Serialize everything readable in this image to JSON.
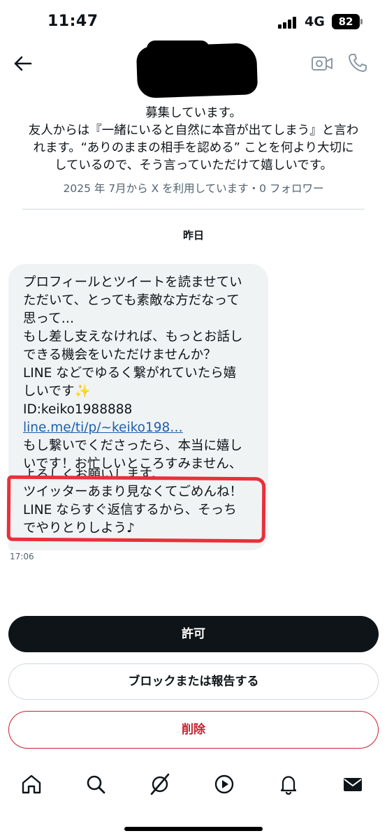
{
  "status_bar": {
    "time": "11:47",
    "network": "4G",
    "battery": "82"
  },
  "header": {
    "back_icon": "arrow-left-icon",
    "name_redacted": true,
    "video_icon": "video-camera-icon",
    "phone_icon": "phone-icon"
  },
  "profile": {
    "bio_lines": [
      "募集しています。",
      "友人からは『一緒にいると自然に本音が出てしまう』と言わ",
      "れます。“ありのままの相手を認める” ことを何より大切に",
      "しているので、そう言っていただけて嬉しいです。"
    ],
    "joined_text": "2025 年 7月から X を利用しています・0 フォロワー"
  },
  "conversation": {
    "date_separator": "昨日",
    "message": {
      "lines": [
        "プロフィールとツイートを読ませてい",
        "ただいて、とっても素敵な方だなって",
        "思って…",
        "もし差し支えなければ、もっとお話し",
        "できる機会をいただけませんか？",
        "LINE などでゆるく繋がれていたら嬉",
        "しいです✨",
        "ID:keiko1988888"
      ],
      "link": "line.me/ti/p/~keiko198…",
      "lines_after_link": [
        "もし繋いでくださったら、本当に嬉し",
        "いです！お忙しいところすみません、"
      ],
      "cutoff_line": "よろしくお願いします。",
      "highlighted_lines": [
        "ツイッターあまり見なくてごめんね！",
        "LINE ならすぐ返信するから、そっち",
        "でやりとりしよう♪"
      ],
      "time": "17:06"
    }
  },
  "actions": {
    "allow_label": "許可",
    "block_report_label": "ブロックまたは報告する",
    "delete_label": "削除"
  },
  "bottom_nav": {
    "items": [
      "home-icon",
      "search-icon",
      "grok-icon",
      "video-play-icon",
      "notifications-bell-icon",
      "messages-envelope-icon"
    ]
  },
  "colors": {
    "bubble": "#eff3f4",
    "primary_button": "#0f1419",
    "delete_red": "#c8202f",
    "highlight_red": "#e8303a",
    "link_blue": "#1d5fae",
    "muted_text": "#536471"
  }
}
